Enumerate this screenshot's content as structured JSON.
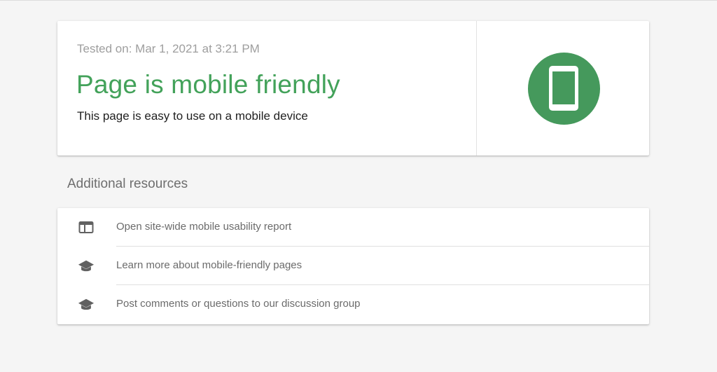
{
  "result": {
    "tested_on": "Tested on: Mar 1, 2021 at 3:21 PM",
    "title": "Page is mobile friendly",
    "subtitle": "This page is easy to use on a mobile device",
    "icon": "smartphone-icon"
  },
  "resources": {
    "heading": "Additional resources",
    "items": [
      {
        "label": "Open site-wide mobile usability report",
        "icon": "web-layout-icon"
      },
      {
        "label": "Learn more about mobile-friendly pages",
        "icon": "graduation-cap-icon"
      },
      {
        "label": "Post comments or questions to our discussion group",
        "icon": "graduation-cap-icon"
      }
    ]
  },
  "colors": {
    "success_green": "#43a25a",
    "badge_green": "#45995c",
    "icon_gray": "#616161"
  }
}
